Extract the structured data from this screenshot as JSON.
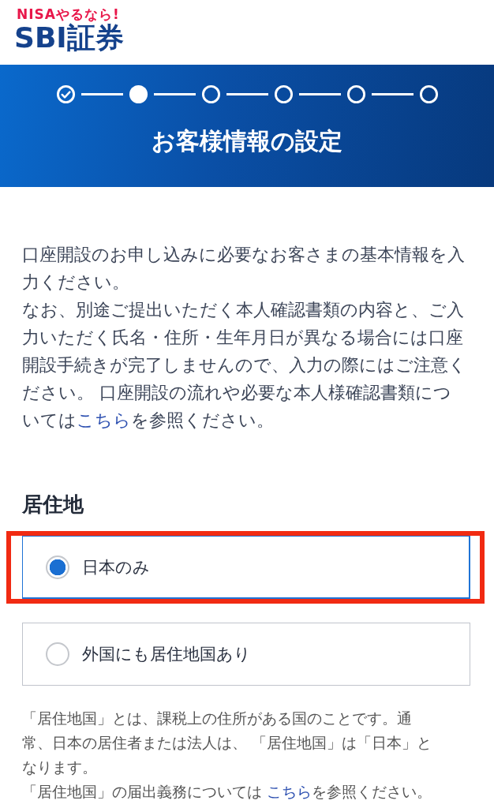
{
  "header": {
    "tagline": "NISAやるなら!",
    "logo": "SBI証券"
  },
  "banner": {
    "steps": [
      {
        "completed": true,
        "current": false
      },
      {
        "completed": false,
        "current": true
      },
      {
        "completed": false,
        "current": false
      },
      {
        "completed": false,
        "current": false
      },
      {
        "completed": false,
        "current": false
      },
      {
        "completed": false,
        "current": false
      }
    ],
    "title": "お客様情報の設定"
  },
  "intro": [
    {
      "before": "口座開設のお申し込みに必要なお客さまの基本情報を入力ください。"
    },
    {
      "before": "なお、別途ご提出いただく本人確認書類の内容と、ご入力いただく氏名・住所・生年月日が異なる場合には口座開設手続きが完了しませんので、入力の際にはご注意ください。 口座開設の流れや必要な本人様確認書類については",
      "link": "こちら",
      "after": "を参照ください。"
    }
  ],
  "residence": {
    "heading": "居住地",
    "options": [
      {
        "label": "日本のみ",
        "selected": true,
        "highlighted": true
      },
      {
        "label": "外国にも居住地国あり",
        "selected": false,
        "highlighted": false
      }
    ],
    "notes": [
      {
        "before": "「居住地国」とは、課税上の住所がある国のことです。通常、日本の居住者または法人は、 「居住地国」は「日本」となります。"
      },
      {
        "before": "「居住地国」の届出義務については ",
        "link": "こちら",
        "after": "を参照ください。"
      }
    ]
  }
}
